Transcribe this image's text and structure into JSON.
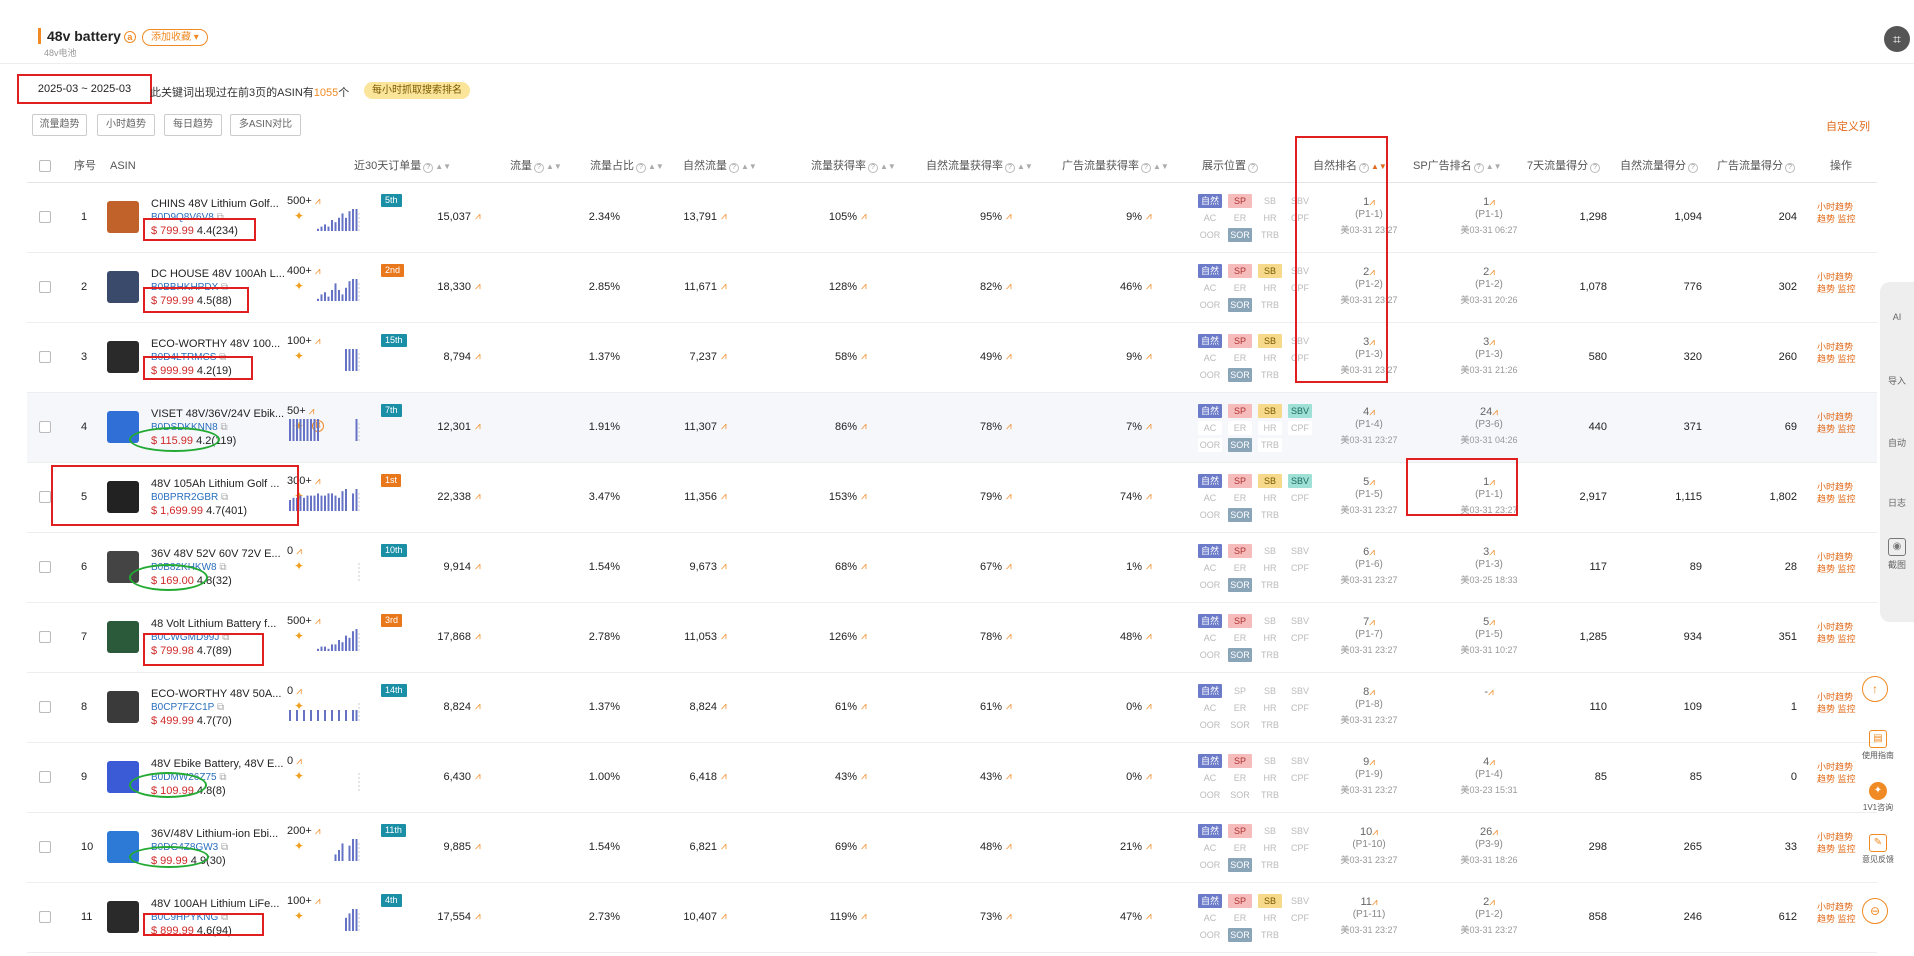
{
  "header": {
    "keyword": "48v battery",
    "keyword_sub": "48v电池",
    "fav_button": "添加收藏",
    "date_range": "2025-03 ~ 2025-03",
    "summary_prefix": "此关键词出现过在前3页的ASIN有",
    "summary_count": "1055",
    "summary_suffix": "个",
    "hourly_pill": "每小时抓取搜索排名"
  },
  "toolbar": {
    "buttons": [
      "流量趋势",
      "小时趋势",
      "每日趋势",
      "多ASIN对比"
    ],
    "custom_columns": "自定义列"
  },
  "columns": [
    "序号",
    "ASIN",
    "近30天订单量",
    "流量",
    "流量占比",
    "自然流量",
    "流量获得率",
    "自然流量获得率",
    "广告流量获得率",
    "展示位置",
    "自然排名",
    "SP广告排名",
    "7天流量得分",
    "自然流量得分",
    "广告流量得分",
    "操作"
  ],
  "tag_labels": [
    "自然",
    "SP",
    "SB",
    "SBV",
    "AC",
    "ER",
    "HR",
    "CPF",
    "OOR",
    "SOR",
    "TRB"
  ],
  "ops": {
    "hourly": "小时趋势",
    "trend": "趋势",
    "monitor": "监控"
  },
  "colors": {
    "accent": "#f08a24",
    "annotation_red": "#e02020",
    "annotation_green": "#22aa33",
    "asin_blue": "#2a6fbd",
    "price_red": "#d02a2a"
  },
  "rows": [
    {
      "idx": "1",
      "title": "CHINS 48V Lithium Golf...",
      "asin": "B0D9Q8V6V8",
      "price": "$ 799.99",
      "rating": "4.4(234)",
      "orders": "500+",
      "badge": "5th",
      "badge_color": "#1b8fa6",
      "traffic": "15,037",
      "share": "2.34%",
      "organic": "13,791",
      "rate": "105%",
      "org_rate": "95%",
      "ad_rate": "9%",
      "tags": [
        1,
        1,
        0,
        0,
        0,
        0,
        0,
        0,
        0,
        1,
        0
      ],
      "nat1": "1",
      "nat2": "(P1-1)",
      "nat3": "美03-31 23:27",
      "sp1": "1",
      "sp2": "(P1-1)",
      "sp3": "美03-31 06:27",
      "s7": "1,298",
      "sorg": "1,094",
      "sad": "204",
      "spark": [
        0,
        0,
        0,
        0,
        0,
        0,
        0,
        0,
        1,
        2,
        3,
        2,
        5,
        4,
        6,
        8,
        6,
        9,
        10,
        10
      ]
    },
    {
      "idx": "2",
      "title": "DC HOUSE 48V 100Ah L...",
      "asin": "B0BBHKHPDX",
      "price": "$ 799.99",
      "rating": "4.5(88)",
      "orders": "400+",
      "badge": "2nd",
      "badge_color": "#e9771c",
      "traffic": "18,330",
      "share": "2.85%",
      "organic": "11,671",
      "rate": "128%",
      "org_rate": "82%",
      "ad_rate": "46%",
      "tags": [
        1,
        1,
        1,
        0,
        0,
        0,
        0,
        0,
        0,
        1,
        0
      ],
      "nat1": "2",
      "nat2": "(P1-2)",
      "nat3": "美03-31 23:27",
      "sp1": "2",
      "sp2": "(P1-2)",
      "sp3": "美03-31 20:26",
      "s7": "1,078",
      "sorg": "776",
      "sad": "302",
      "spark": [
        0,
        0,
        0,
        0,
        0,
        0,
        0,
        0,
        1,
        3,
        4,
        2,
        5,
        8,
        5,
        3,
        6,
        9,
        10,
        10
      ]
    },
    {
      "idx": "3",
      "title": "ECO-WORTHY 48V 100...",
      "asin": "B0D4LTRMCS",
      "price": "$ 999.99",
      "rating": "4.2(19)",
      "orders": "100+",
      "badge": "15th",
      "badge_color": "#1b8fa6",
      "traffic": "8,794",
      "share": "1.37%",
      "organic": "7,237",
      "rate": "58%",
      "org_rate": "49%",
      "ad_rate": "9%",
      "tags": [
        1,
        1,
        1,
        0,
        0,
        0,
        0,
        0,
        0,
        1,
        0
      ],
      "nat1": "3",
      "nat2": "(P1-3)",
      "nat3": "美03-31 23:27",
      "sp1": "3",
      "sp2": "(P1-3)",
      "sp3": "美03-31 21:26",
      "s7": "580",
      "sorg": "320",
      "sad": "260",
      "spark": [
        0,
        0,
        0,
        0,
        0,
        0,
        0,
        0,
        0,
        0,
        0,
        0,
        0,
        0,
        0,
        0,
        10,
        10,
        10,
        10
      ]
    },
    {
      "idx": "4",
      "title": "VISET 48V/36V/24V Ebik...",
      "asin": "B0DSDKKNN8",
      "price": "$ 115.99",
      "rating": "4.2(119)",
      "orders": "50+",
      "badge": "7th",
      "badge_color": "#1b8fa6",
      "traffic": "12,301",
      "share": "1.91%",
      "organic": "11,307",
      "rate": "86%",
      "org_rate": "78%",
      "ad_rate": "7%",
      "tags": [
        1,
        1,
        1,
        1,
        0,
        0,
        0,
        0,
        0,
        1,
        0
      ],
      "nat1": "4",
      "nat2": "(P1-4)",
      "nat3": "美03-31 23:27",
      "sp1": "24",
      "sp2": "(P3-6)",
      "sp3": "美03-31 04:26",
      "s7": "440",
      "sorg": "371",
      "sad": "69",
      "spark": [
        10,
        10,
        10,
        10,
        10,
        10,
        10,
        10,
        10,
        0,
        0,
        0,
        0,
        0,
        0,
        0,
        0,
        0,
        0,
        10
      ]
    },
    {
      "idx": "5",
      "title": "48V 105Ah Lithium Golf ...",
      "asin": "B0BPRR2GBR",
      "price": "$ 1,699.99",
      "rating": "4.7(401)",
      "orders": "300+",
      "badge": "1st",
      "badge_color": "#e9771c",
      "traffic": "22,338",
      "share": "3.47%",
      "organic": "11,356",
      "rate": "153%",
      "org_rate": "79%",
      "ad_rate": "74%",
      "tags": [
        1,
        1,
        1,
        1,
        0,
        0,
        0,
        0,
        0,
        1,
        0
      ],
      "nat1": "5",
      "nat2": "(P1-5)",
      "nat3": "美03-31 23:27",
      "sp1": "1",
      "sp2": "(P1-1)",
      "sp3": "美03-31 23:27",
      "s7": "2,917",
      "sorg": "1,115",
      "sad": "1,802",
      "spark": [
        5,
        6,
        6,
        7,
        6,
        7,
        7,
        7,
        8,
        7,
        7,
        8,
        8,
        7,
        6,
        9,
        10,
        0,
        8,
        10
      ]
    },
    {
      "idx": "6",
      "title": "36V 48V 52V 60V 72V E...",
      "asin": "B0B82KHKW8",
      "price": "$ 169.00",
      "rating": "4.8(32)",
      "orders": "0",
      "badge": "10th",
      "badge_color": "#1b8fa6",
      "traffic": "9,914",
      "share": "1.54%",
      "organic": "9,673",
      "rate": "68%",
      "org_rate": "67%",
      "ad_rate": "1%",
      "tags": [
        1,
        1,
        0,
        0,
        0,
        0,
        0,
        0,
        0,
        1,
        0
      ],
      "nat1": "6",
      "nat2": "(P1-6)",
      "nat3": "美03-31 23:27",
      "sp1": "3",
      "sp2": "(P1-3)",
      "sp3": "美03-25 18:33",
      "s7": "117",
      "sorg": "89",
      "sad": "28",
      "spark": [
        0,
        0,
        0,
        0,
        0,
        0,
        0,
        0,
        0,
        0,
        0,
        0,
        0,
        0,
        0,
        0,
        0,
        0,
        0,
        0
      ]
    },
    {
      "idx": "7",
      "title": "48 Volt Lithium Battery f...",
      "asin": "B0CWGMD99J",
      "price": "$ 799.98",
      "rating": "4.7(89)",
      "orders": "500+",
      "badge": "3rd",
      "badge_color": "#e9771c",
      "traffic": "17,868",
      "share": "2.78%",
      "organic": "11,053",
      "rate": "126%",
      "org_rate": "78%",
      "ad_rate": "48%",
      "tags": [
        1,
        1,
        0,
        0,
        0,
        0,
        0,
        0,
        0,
        1,
        0
      ],
      "nat1": "7",
      "nat2": "(P1-7)",
      "nat3": "美03-31 23:27",
      "sp1": "5",
      "sp2": "(P1-5)",
      "sp3": "美03-31 10:27",
      "s7": "1,285",
      "sorg": "934",
      "sad": "351",
      "spark": [
        0,
        0,
        0,
        0,
        0,
        0,
        0,
        0,
        1,
        2,
        2,
        1,
        3,
        3,
        5,
        4,
        7,
        6,
        9,
        10
      ]
    },
    {
      "idx": "8",
      "title": "ECO-WORTHY 48V 50A...",
      "asin": "B0CP7FZC1P",
      "price": "$ 499.99",
      "rating": "4.7(70)",
      "orders": "0",
      "badge": "14th",
      "badge_color": "#1b8fa6",
      "traffic": "8,824",
      "share": "1.37%",
      "organic": "8,824",
      "rate": "61%",
      "org_rate": "61%",
      "ad_rate": "0%",
      "tags": [
        1,
        0,
        0,
        0,
        0,
        0,
        0,
        0,
        0,
        0,
        0
      ],
      "nat1": "8",
      "nat2": "(P1-8)",
      "nat3": "美03-31 23:27",
      "sp1": "-",
      "sp2": "",
      "sp3": "",
      "s7": "110",
      "sorg": "109",
      "sad": "1",
      "spark": [
        5,
        0,
        5,
        0,
        5,
        0,
        5,
        0,
        5,
        0,
        5,
        0,
        5,
        0,
        5,
        0,
        5,
        0,
        5,
        5
      ]
    },
    {
      "idx": "9",
      "title": "48V Ebike Battery, 48V E...",
      "asin": "B0DMW26Z75",
      "price": "$ 109.99",
      "rating": "4.8(8)",
      "orders": "0",
      "badge": "",
      "badge_color": "",
      "traffic": "6,430",
      "share": "1.00%",
      "organic": "6,418",
      "rate": "43%",
      "org_rate": "43%",
      "ad_rate": "0%",
      "tags": [
        1,
        1,
        0,
        0,
        0,
        0,
        0,
        0,
        0,
        0,
        0
      ],
      "nat1": "9",
      "nat2": "(P1-9)",
      "nat3": "美03-31 23:27",
      "sp1": "4",
      "sp2": "(P1-4)",
      "sp3": "美03-23 15:31",
      "s7": "85",
      "sorg": "85",
      "sad": "0",
      "spark": [
        0,
        0,
        0,
        0,
        0,
        0,
        0,
        0,
        0,
        0,
        0,
        0,
        0,
        0,
        0,
        0,
        0,
        0,
        0,
        0
      ]
    },
    {
      "idx": "10",
      "title": "36V/48V Lithium-ion Ebi...",
      "asin": "B0DG4Z8GW3",
      "price": "$ 99.99",
      "rating": "4.9(30)",
      "orders": "200+",
      "badge": "11th",
      "badge_color": "#1b8fa6",
      "traffic": "9,885",
      "share": "1.54%",
      "organic": "6,821",
      "rate": "69%",
      "org_rate": "48%",
      "ad_rate": "21%",
      "tags": [
        1,
        1,
        0,
        0,
        0,
        0,
        0,
        0,
        0,
        1,
        0
      ],
      "nat1": "10",
      "nat2": "(P1-10)",
      "nat3": "美03-31 23:27",
      "sp1": "26",
      "sp2": "(P3-9)",
      "sp3": "美03-31 18:26",
      "s7": "298",
      "sorg": "265",
      "sad": "33",
      "spark": [
        0,
        0,
        0,
        0,
        0,
        0,
        0,
        0,
        0,
        0,
        0,
        0,
        0,
        3,
        5,
        8,
        0,
        7,
        10,
        10
      ]
    },
    {
      "idx": "11",
      "title": "48V 100AH Lithium LiFe...",
      "asin": "B0C9HPYKNG",
      "price": "$ 899.99",
      "rating": "4.6(94)",
      "orders": "100+",
      "badge": "4th",
      "badge_color": "#1b8fa6",
      "traffic": "17,554",
      "share": "2.73%",
      "organic": "10,407",
      "rate": "119%",
      "org_rate": "73%",
      "ad_rate": "47%",
      "tags": [
        1,
        1,
        1,
        0,
        0,
        0,
        0,
        0,
        0,
        1,
        0
      ],
      "nat1": "11",
      "nat2": "(P1-11)",
      "nat3": "美03-31 23:27",
      "sp1": "2",
      "sp2": "(P1-2)",
      "sp3": "美03-31 23:27",
      "s7": "858",
      "sorg": "246",
      "sad": "612",
      "spark": [
        0,
        0,
        0,
        0,
        0,
        0,
        0,
        0,
        0,
        0,
        0,
        0,
        0,
        0,
        0,
        0,
        6,
        8,
        10,
        10
      ]
    }
  ],
  "side_panel": {
    "items": [
      "AI",
      "导入",
      "自动",
      "日志",
      "截图"
    ]
  },
  "help_panel": {
    "items": [
      "使用指南",
      "1V1咨询",
      "意见反馈"
    ]
  }
}
